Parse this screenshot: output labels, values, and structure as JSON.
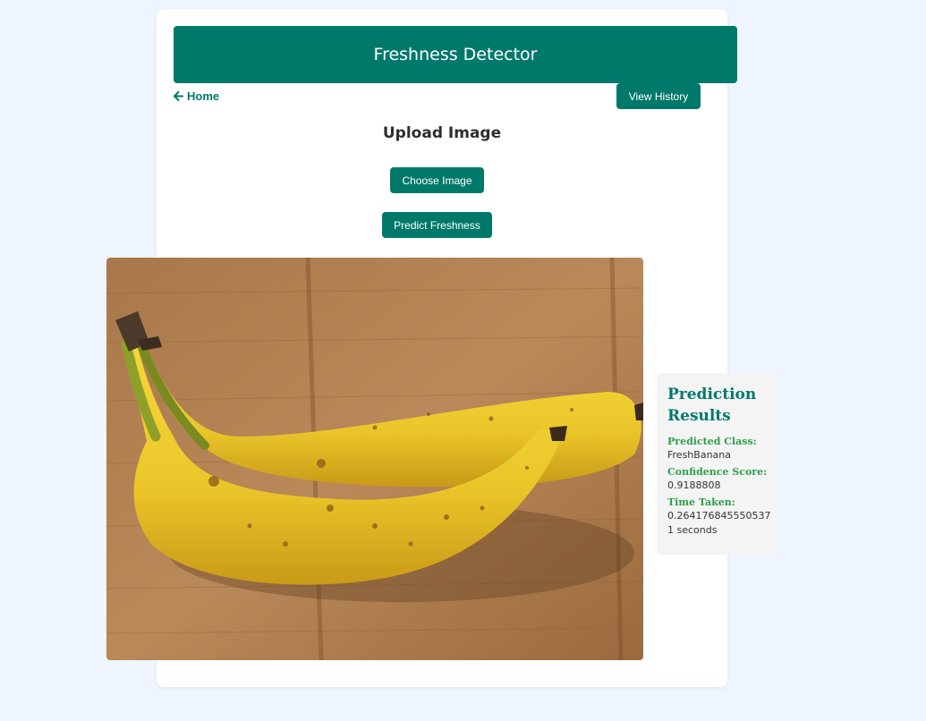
{
  "app": {
    "title": "Freshness Detector"
  },
  "nav": {
    "home_label": "Home",
    "history_label": "View History"
  },
  "upload": {
    "title": "Upload Image",
    "choose_label": "Choose Image",
    "predict_label": "Predict Freshness"
  },
  "results": {
    "title": "Prediction Results",
    "class_label": "Predicted Class:",
    "class_value": "FreshBanana",
    "confidence_label": "Confidence Score:",
    "confidence_value": "0.9188808",
    "time_label": "Time Taken:",
    "time_value": "0.2641768455505371 seconds"
  },
  "colors": {
    "primary": "#00796b",
    "background": "#eef5fe",
    "result_label": "#2e9e4a"
  }
}
